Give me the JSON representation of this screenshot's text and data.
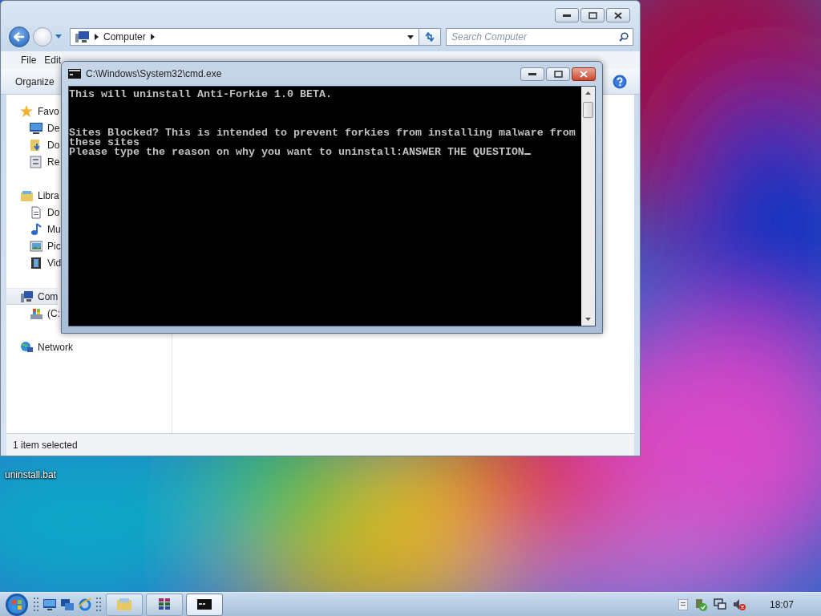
{
  "explorer": {
    "breadcrumb": "Computer",
    "search": {
      "placeholder": "Search Computer"
    },
    "menu": [
      "File",
      "Edit"
    ],
    "toolbar": [
      "Organize"
    ],
    "nav": [
      {
        "label": "Favo",
        "kind": "favorites",
        "selected": false,
        "children": [
          {
            "label": "De",
            "kind": "desktop",
            "selected": false
          },
          {
            "label": "Do",
            "kind": "downloads",
            "selected": false
          },
          {
            "label": "Re",
            "kind": "recent",
            "selected": false
          }
        ]
      },
      {
        "label": "Libra",
        "kind": "libraries",
        "selected": false,
        "children": [
          {
            "label": "Do",
            "kind": "document",
            "selected": false
          },
          {
            "label": "Mu",
            "kind": "music",
            "selected": false
          },
          {
            "label": "Pic",
            "kind": "pictures",
            "selected": false
          },
          {
            "label": "Vid",
            "kind": "videos",
            "selected": false
          }
        ]
      },
      {
        "label": "Com",
        "kind": "computer",
        "selected": true,
        "children": [
          {
            "label": "(C:",
            "kind": "drive",
            "selected": false
          }
        ]
      },
      {
        "label": "Network",
        "kind": "network",
        "selected": false
      }
    ],
    "status": "1 item selected"
  },
  "console": {
    "title": "C:\\Windows\\System32\\cmd.exe",
    "messages": [
      "This will uninstall Anti-Forkie 1.0 BETA.",
      "Sites Blocked? This is intended to prevent forkies from installing malware from these sites"
    ],
    "prompt": "Please type the reason on why you want to uninstall:",
    "input": {
      "value": "ANSWER THE QUESTION"
    }
  },
  "desktop_icons": [
    {
      "label": "uninstall.bat"
    }
  ],
  "taskbar": {
    "buttons": [
      {
        "kind": "explorer",
        "selected": false
      },
      {
        "kind": "archive",
        "selected": false
      },
      {
        "kind": "console",
        "selected": true
      }
    ],
    "clock": "18:07"
  }
}
